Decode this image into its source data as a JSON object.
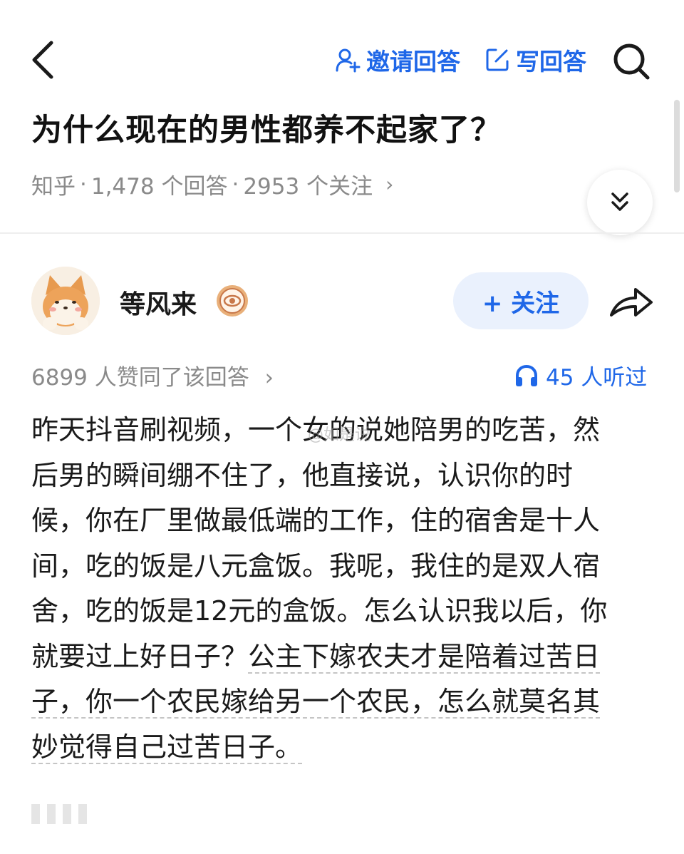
{
  "header": {
    "invite_label": "邀请回答",
    "write_label": "写回答"
  },
  "question": {
    "title": "为什么现在的男性都养不起家了？",
    "source": "知乎",
    "separator": "·",
    "answers_count": "1,478 个回答",
    "followers_count": "2953 个关注",
    "chevron": "›"
  },
  "answer": {
    "author": "等风来",
    "follow_label": "+ 关注",
    "upvotes": "6899 人赞同了该回答",
    "upvotes_chevron": "›",
    "listened": "45 人听过",
    "watermark": "@如是说",
    "lines": [
      "昨天抖音刷视频，一个女的说她陪男的吃苦，然",
      "后男的瞬间绷不住了，他直接说，认识你的时",
      "候，你在厂里做最低端的工作，住的宿舍是十人",
      "间，吃的饭是八元盒饭。我呢，我住的是双人宿",
      "舍，吃的饭是12元的盒饭。怎么认识我以后，你"
    ],
    "line6_plain": "就要过上好日子？",
    "line6_dashed": "公主下嫁农夫才是陪着过苦日",
    "line7": "子，你一个农民嫁给另一个农民，怎么就莫名其",
    "line8": "妙觉得自己过苦日子。"
  },
  "colors": {
    "accent": "#1f67e8",
    "muted": "#8a8a8a",
    "follow_bg": "#eaf1fd"
  }
}
